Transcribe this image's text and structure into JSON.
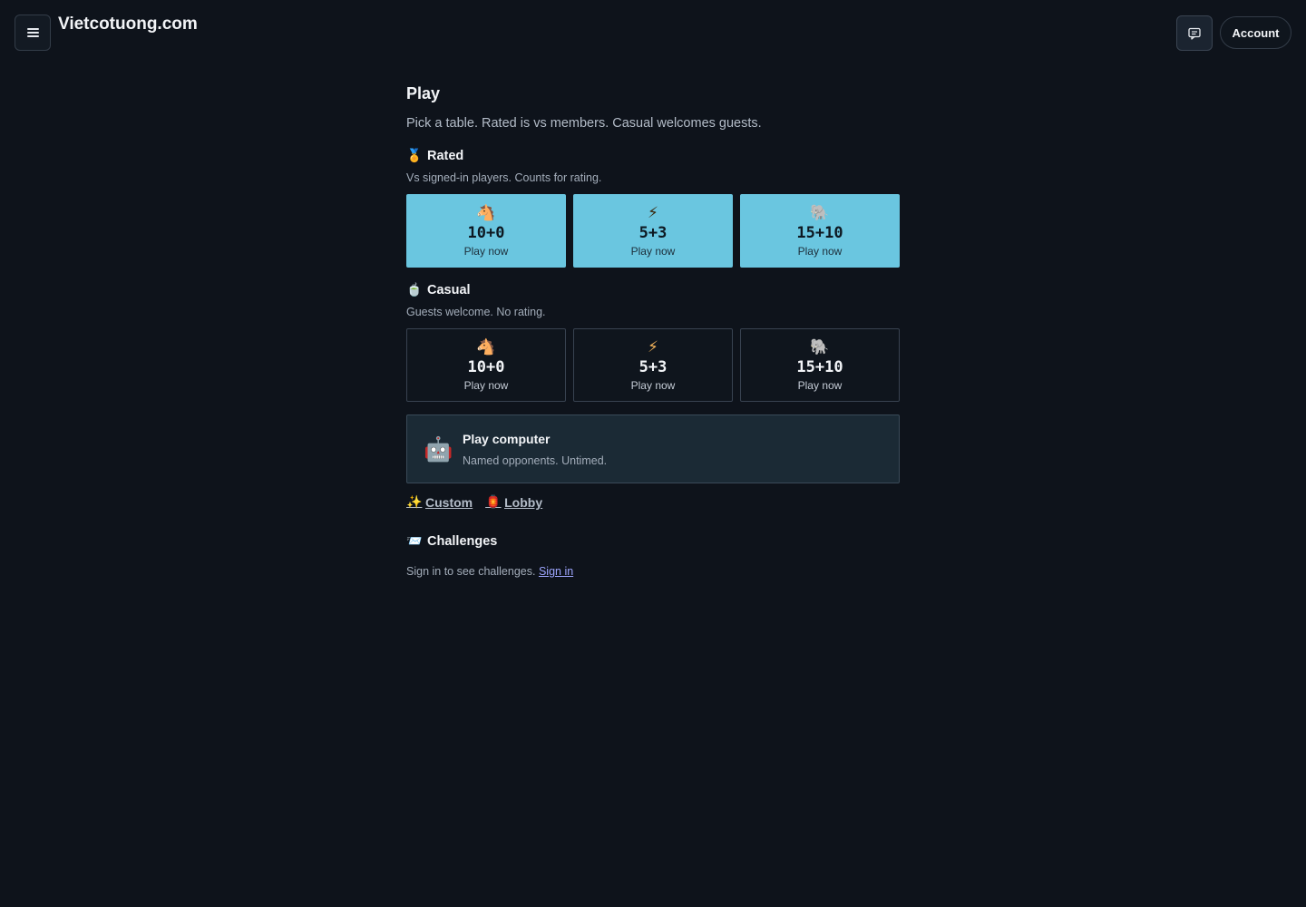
{
  "header": {
    "site_title": "Vietcotuong.com",
    "account_label": "Account"
  },
  "page": {
    "title": "Play",
    "description": "Pick a table. Rated is vs members. Casual welcomes guests."
  },
  "rated": {
    "icon": "🏅",
    "title": "Rated",
    "subtitle": "Vs signed-in players. Counts for rating.",
    "tiles": [
      {
        "icon": "🐴",
        "time": "10+0",
        "action": "Play now"
      },
      {
        "icon": "⚡",
        "time": "5+3",
        "action": "Play now"
      },
      {
        "icon": "🐘",
        "time": "15+10",
        "action": "Play now"
      }
    ]
  },
  "casual": {
    "icon": "🍵",
    "title": "Casual",
    "subtitle": "Guests welcome. No rating.",
    "tiles": [
      {
        "icon": "🐴",
        "time": "10+0",
        "action": "Play now"
      },
      {
        "icon": "⚡",
        "time": "5+3",
        "action": "Play now"
      },
      {
        "icon": "🐘",
        "time": "15+10",
        "action": "Play now"
      }
    ]
  },
  "computer": {
    "icon": "🤖",
    "title": "Play computer",
    "subtitle": "Named opponents. Untimed."
  },
  "links": {
    "custom_icon": "✨",
    "custom_label": "Custom",
    "lobby_icon": "🏮",
    "lobby_label": "Lobby"
  },
  "challenges": {
    "icon": "📨",
    "title": "Challenges",
    "message": "Sign in to see challenges.",
    "signin_label": "Sign in"
  }
}
